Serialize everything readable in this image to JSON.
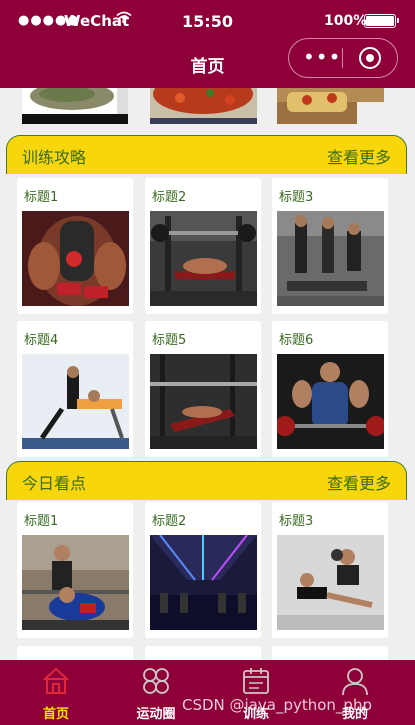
{
  "status_bar": {
    "signal": "●●●●●",
    "carrier": "WeChat",
    "time": "15:50",
    "battery": "100%"
  },
  "navbar": {
    "title": "首页",
    "menu_icon": "more-dots-icon",
    "close_icon": "target-icon"
  },
  "sections": [
    {
      "title": "训练攻略",
      "more_label": "查看更多",
      "cards": [
        {
          "title": "标题1",
          "image": "muscular-arm-image"
        },
        {
          "title": "标题2",
          "image": "bench-press-image"
        },
        {
          "title": "标题3",
          "image": "group-training-image"
        },
        {
          "title": "标题4",
          "image": "yoga-coach-image"
        },
        {
          "title": "标题5",
          "image": "incline-bench-image"
        },
        {
          "title": "标题6",
          "image": "barbell-athlete-image"
        }
      ]
    },
    {
      "title": "今日看点",
      "more_label": "查看更多",
      "cards": [
        {
          "title": "标题1",
          "image": "spotter-bench-image"
        },
        {
          "title": "标题2",
          "image": "gym-hall-image"
        },
        {
          "title": "标题3",
          "image": "partner-workout-image"
        }
      ]
    }
  ],
  "tabbar": {
    "items": [
      {
        "label": "首页",
        "icon": "home-icon",
        "active": true
      },
      {
        "label": "运动圈",
        "icon": "grid-icon",
        "active": false
      },
      {
        "label": "训练",
        "icon": "calendar-icon",
        "active": false
      },
      {
        "label": "我的",
        "icon": "user-icon",
        "active": false
      }
    ]
  },
  "watermark": "CSDN @java_python_php",
  "colors": {
    "brand": "#8f0038",
    "section_header": "#f7d70b",
    "section_text": "#3a6b1e",
    "active_tab": "#f5e300"
  }
}
